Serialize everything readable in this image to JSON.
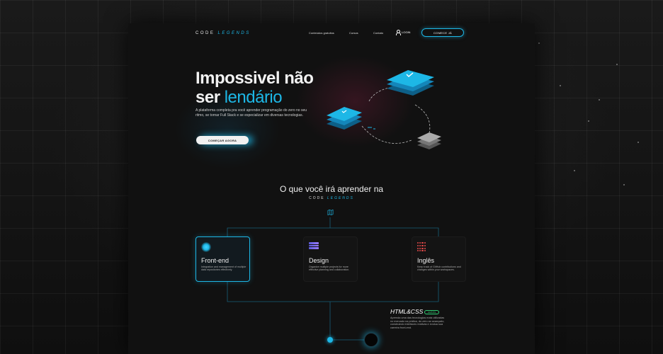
{
  "header": {
    "logo_main": "CODE",
    "logo_accent": "LEGENDS",
    "nav": [
      "Conteúdos gratuitos",
      "Cursos",
      "Contato"
    ],
    "login": "LOGIN",
    "cta": "COMECE JÁ"
  },
  "hero": {
    "title_line1": "Impossivel não",
    "title_line2_a": "ser",
    "title_line2_b": "lendário",
    "paragraph": "A plataforma completa pra você aprender programação do zero no seu ritmo, se tornar Full Stack e se especializar em diversas tecnologias.",
    "button": "COMEÇAR AGORA"
  },
  "section": {
    "title": "O que você irá aprender na",
    "logo_main": "CODE",
    "logo_accent": "LEGENDS"
  },
  "cards": [
    {
      "title": "Front-end",
      "desc": "Integration and management of multiple data repositories effectively.",
      "icon": "glow-dot-icon"
    },
    {
      "title": "Design",
      "desc": "Organize multiple projects for more effective planning and collaboration.",
      "icon": "layers-icon"
    },
    {
      "title": "Inglês",
      "desc": "Keep track of GitHub contributions and changes within your workspaces.",
      "icon": "dots-grid-icon"
    }
  ],
  "module": {
    "title": "HTML&CSS",
    "badge": "GRÁTIS",
    "desc": "Aprenda uma das tecnologias mais utilizadas no mercado na prática, do zero ao avançado, construindo interfaces reativas e evolua sua carreira front-end."
  },
  "colors": {
    "accent": "#1db7e6",
    "background": "#111111",
    "badge": "#2ecc71"
  }
}
